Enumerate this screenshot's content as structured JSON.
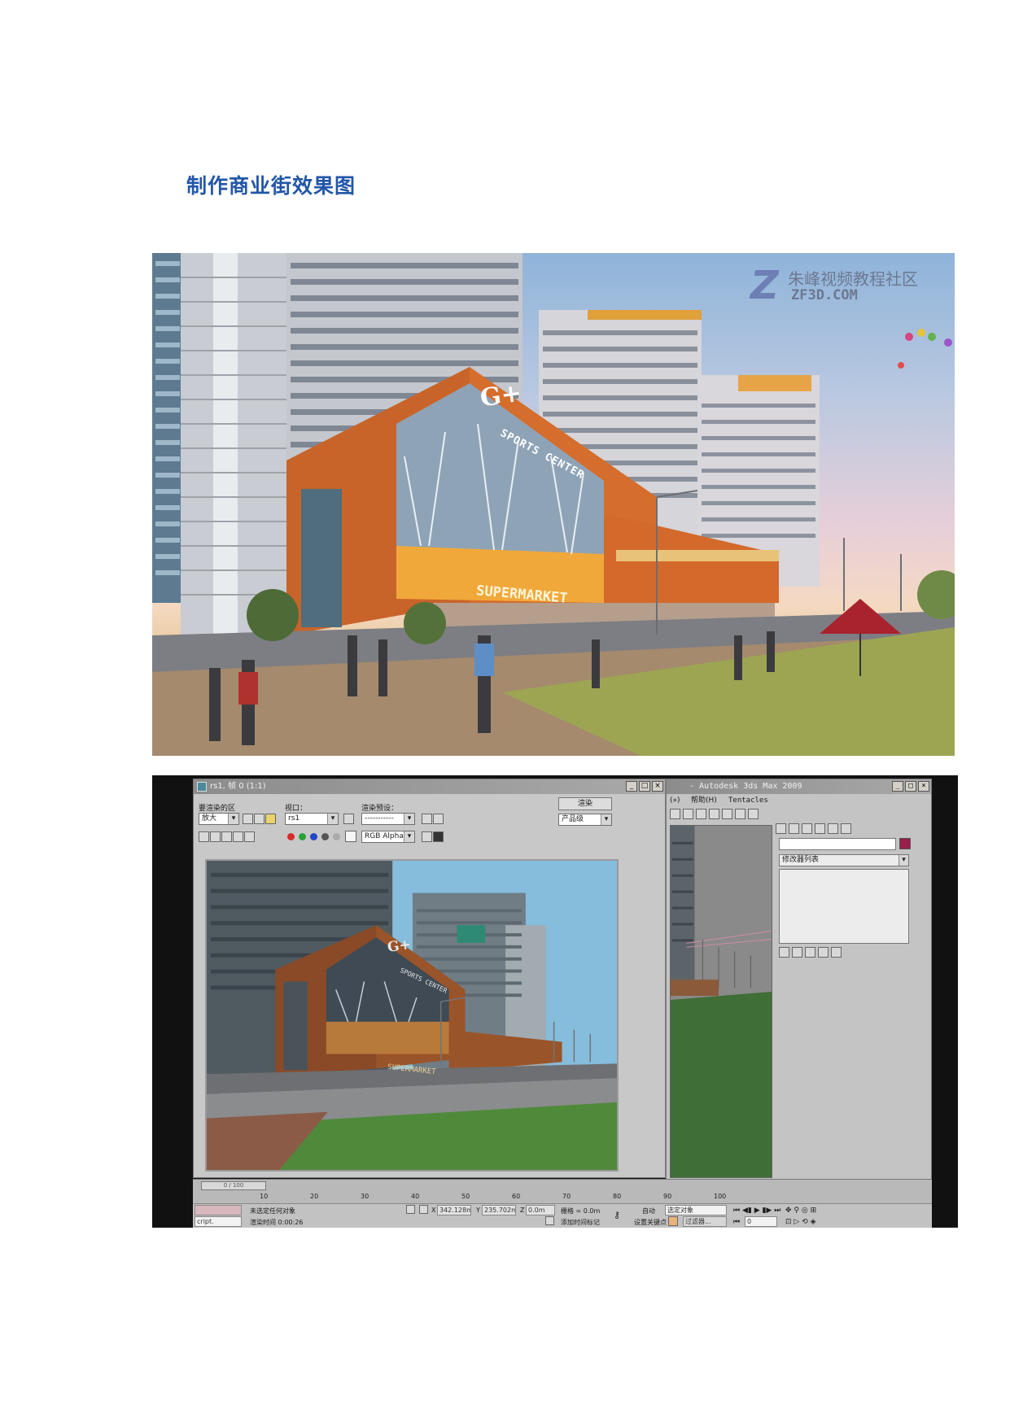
{
  "document": {
    "title": "制作商业街效果图"
  },
  "photo": {
    "watermark_cn": "朱峰视频教程社区",
    "watermark_en": "ZF3D.COM",
    "sign_g": "G+",
    "sign_sports": "SPORTS CENTER",
    "sign_super": "SUPERMARKET"
  },
  "render_window": {
    "title": "rs1, 帧 0 (1:1)",
    "area_label": "要渲染的区",
    "area_value": "放大",
    "viewport_label": "视口：",
    "viewport_value": "rs1",
    "preset_label": "渲染预设：",
    "preset_value": "-----------",
    "render_button": "渲染",
    "quality_value": "产品级",
    "channel_value": "RGB Alpha",
    "vp_sign_g": "G+",
    "vp_sign_sports": "SPORTS CENTER",
    "vp_sign_super": "SUPERMARKET"
  },
  "max_window": {
    "title": "- Autodesk 3ds Max 2009",
    "menu_help": "帮助(H)",
    "menu_tentacles": "Tentacles",
    "modifier_list": "修改器列表"
  },
  "timeline": {
    "slider_label": "0 / 100",
    "ticks": [
      "10",
      "20",
      "30",
      "40",
      "50",
      "60",
      "70",
      "80",
      "90",
      "100"
    ]
  },
  "status": {
    "script_label": "cript.",
    "selection_text": "未选定任何对象",
    "render_time": "渲染时间  0:00:26",
    "x_value": "342.128m",
    "y_value": "235.702m",
    "z_value": "0.0m",
    "grid_value": "栅格 = 0.0m",
    "add_time_tag": "添加时间标记",
    "auto_label": "自动",
    "selected_object": "选定对象",
    "set_key": "设置关键点",
    "filter": "过滤器...",
    "frame_value": "0",
    "x_label": "X",
    "y_label": "Y",
    "z_label": "Z"
  }
}
